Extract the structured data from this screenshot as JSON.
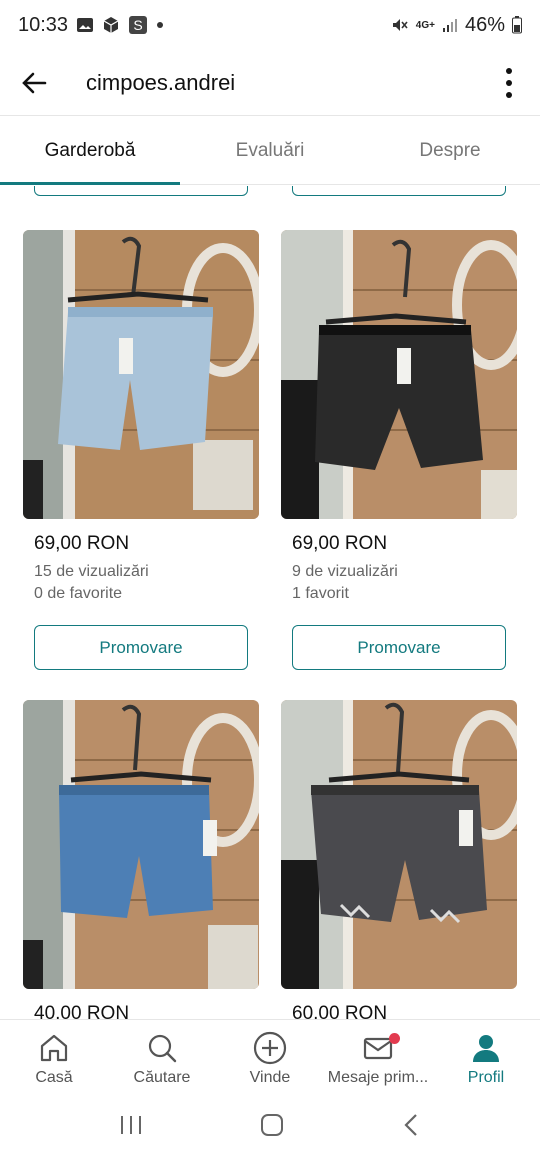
{
  "status": {
    "time": "10:33",
    "battery": "46%",
    "network": "4G+"
  },
  "header": {
    "title": "cimpoes.andrei"
  },
  "tabs": [
    {
      "label": "Garderobă",
      "active": true
    },
    {
      "label": "Evaluări",
      "active": false
    },
    {
      "label": "Despre",
      "active": false
    }
  ],
  "items": [
    {
      "price": "69,00 RON",
      "views": "15 de vizualizări",
      "favs": "0 de favorite",
      "promo": "Promovare",
      "image": "light-blue-denim-shorts"
    },
    {
      "price": "69,00 RON",
      "views": "9 de vizualizări",
      "favs": "1 favorit",
      "promo": "Promovare",
      "image": "black-leather-shorts"
    },
    {
      "price": "40,00 RON",
      "image": "blue-denim-shorts"
    },
    {
      "price": "60,00 RON",
      "image": "dark-grey-denim-shorts"
    }
  ],
  "bottom_nav": [
    {
      "label": "Casă",
      "icon": "home-icon"
    },
    {
      "label": "Căutare",
      "icon": "search-icon"
    },
    {
      "label": "Vinde",
      "icon": "plus-circle-icon"
    },
    {
      "label": "Mesaje prim...",
      "icon": "mail-icon"
    },
    {
      "label": "Profil",
      "icon": "profile-icon",
      "active": true
    }
  ],
  "colors": {
    "accent": "#137a7f",
    "badge": "#e23a4f"
  }
}
